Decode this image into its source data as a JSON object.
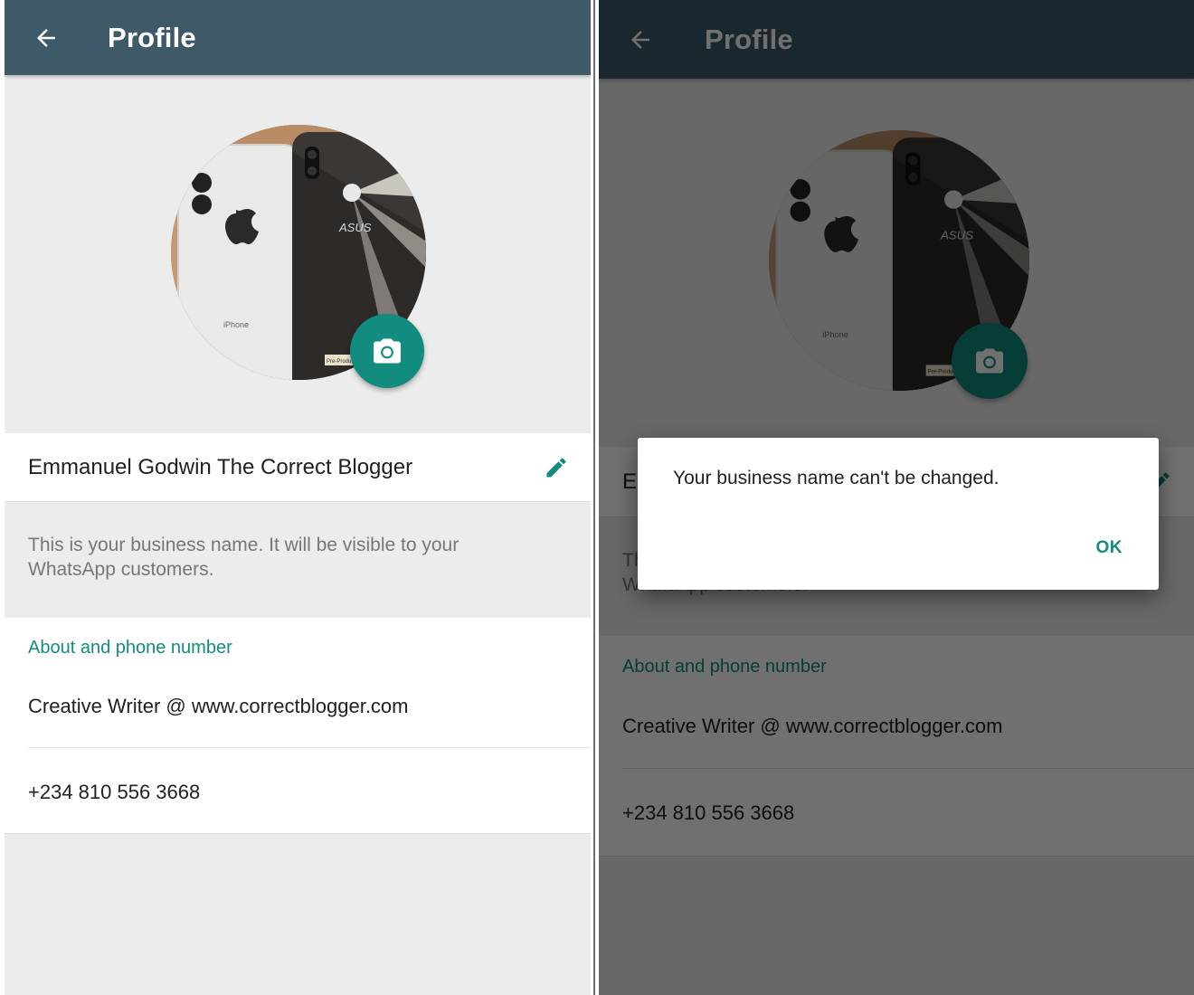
{
  "colors": {
    "appbar": "#3e5a69",
    "accent": "#128c7e",
    "background": "#ececec",
    "text_primary": "#212121",
    "text_secondary": "#777777"
  },
  "profile": {
    "title": "Profile",
    "back_icon": "arrow-back-icon",
    "camera_icon": "camera-icon",
    "edit_icon": "pencil-icon",
    "business_name": "Emmanuel Godwin The Correct Blogger",
    "business_name_hint": "This is your business name. It will be visible to your WhatsApp customers.",
    "about_header": "About and phone number",
    "about": "Creative Writer @ www.correctblogger.com",
    "phone": "+234 810 556 3668",
    "photo_labels": {
      "left_phone_brand": "iPhone",
      "right_phone_brand": "ASUS",
      "sticker": "Pre-Production"
    }
  },
  "dialog": {
    "message": "Your business name can't be changed.",
    "ok_label": "OK"
  }
}
